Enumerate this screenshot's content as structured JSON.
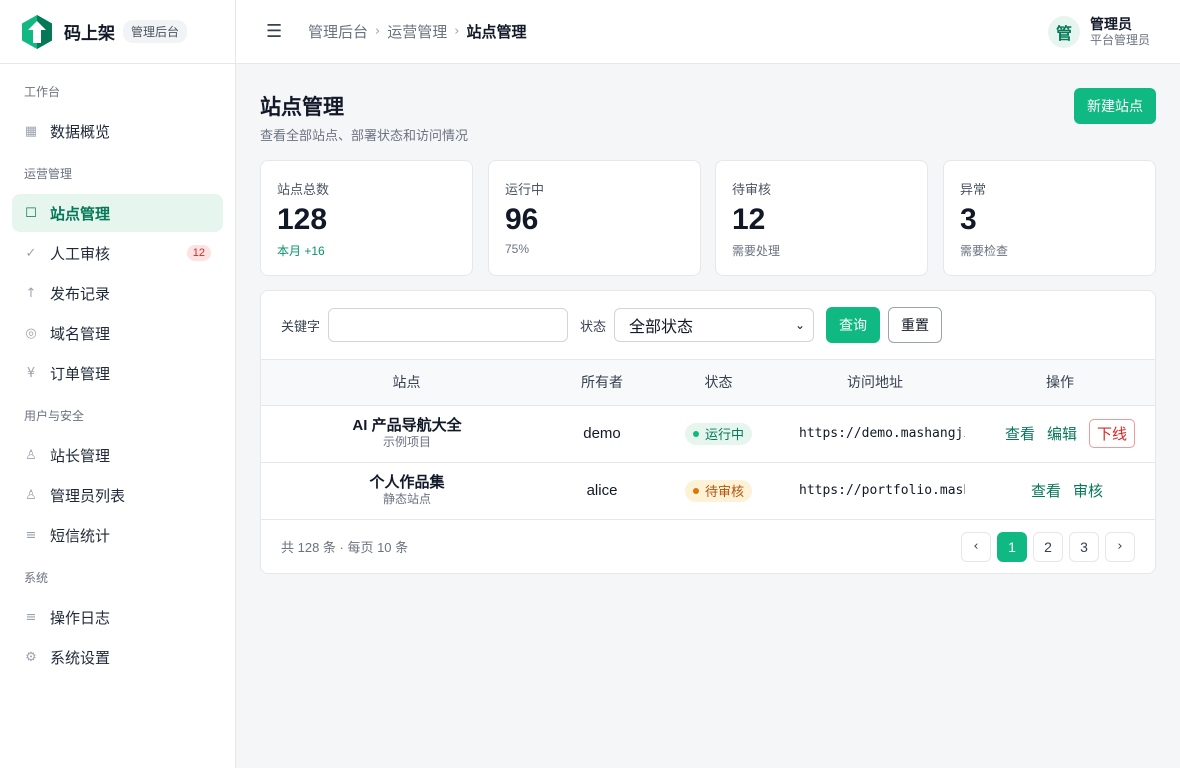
{
  "brand": {
    "name": "码上架",
    "tag": "管理后台"
  },
  "sidebar": {
    "groups": [
      {
        "title": "工作台",
        "items": [
          {
            "label": "数据概览",
            "icon": "grid-icon"
          }
        ]
      },
      {
        "title": "运营管理",
        "items": [
          {
            "label": "站点管理",
            "icon": "square-icon",
            "active": true
          },
          {
            "label": "人工审核",
            "icon": "check-icon",
            "badge": "12"
          },
          {
            "label": "发布记录",
            "icon": "arrow-up-icon"
          },
          {
            "label": "域名管理",
            "icon": "globe-icon"
          },
          {
            "label": "订单管理",
            "icon": "yen-icon"
          }
        ]
      },
      {
        "title": "用户与安全",
        "items": [
          {
            "label": "站长管理",
            "icon": "person-icon"
          },
          {
            "label": "管理员列表",
            "icon": "person-icon"
          },
          {
            "label": "短信统计",
            "icon": "lines-icon"
          }
        ]
      },
      {
        "title": "系统",
        "items": [
          {
            "label": "操作日志",
            "icon": "lines-icon"
          },
          {
            "label": "系统设置",
            "icon": "gear-icon"
          }
        ]
      }
    ]
  },
  "header": {
    "breadcrumb": [
      "管理后台",
      "运营管理",
      "站点管理"
    ],
    "user": {
      "avatar": "管",
      "name": "管理员",
      "role": "平台管理员"
    }
  },
  "page": {
    "title": "站点管理",
    "subtitle": "查看全部站点、部署状态和访问情况",
    "new_button": "新建站点"
  },
  "stats": [
    {
      "label": "站点总数",
      "value": "128",
      "note": "本月 +16",
      "trend": "up"
    },
    {
      "label": "运行中",
      "value": "96",
      "note": "75%"
    },
    {
      "label": "待审核",
      "value": "12",
      "note": "需要处理"
    },
    {
      "label": "异常",
      "value": "3",
      "note": "需要检查"
    }
  ],
  "filter": {
    "keyword_label": "关键字",
    "keyword_value": "",
    "status_label": "状态",
    "status_value": "全部状态",
    "query_button": "查询",
    "reset_button": "重置"
  },
  "table": {
    "headers": [
      "站点",
      "所有者",
      "状态",
      "访问地址",
      "操作"
    ],
    "rows": [
      {
        "name": "AI 产品导航大全",
        "desc": "示例项目",
        "owner": "demo",
        "status": "运行中",
        "url": "https://demo.mashangjia.com",
        "actions": [
          "查看",
          "编辑",
          "下线"
        ]
      },
      {
        "name": "个人作品集",
        "desc": "静态站点",
        "owner": "alice",
        "status": "待审核",
        "url": "https://portfolio.mashangjia.com",
        "actions": [
          "查看",
          "审核"
        ]
      }
    ]
  },
  "pagination": {
    "summary": "共 128 条 · 每页 10 条",
    "prev": "‹",
    "pages": [
      "1",
      "2",
      "3"
    ],
    "current": "1",
    "next": "›"
  },
  "colors": {
    "accent": "#10b981",
    "accent_dark": "#047857",
    "danger": "#dc2626",
    "warning": "#b45309"
  }
}
